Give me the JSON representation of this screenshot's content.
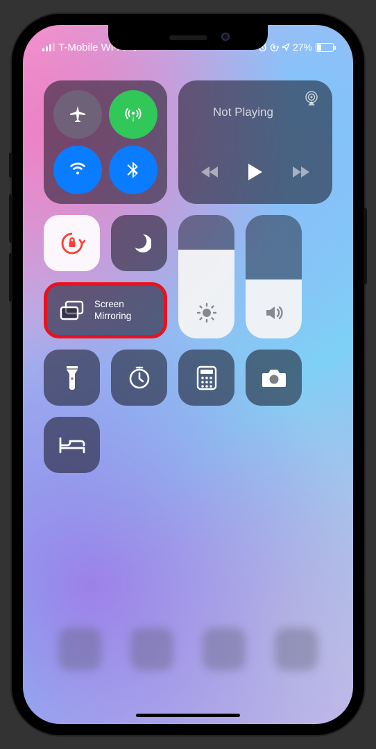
{
  "status": {
    "carrier": "T-Mobile Wi-Fi",
    "battery_pct": "27%"
  },
  "media": {
    "title": "Not Playing"
  },
  "screen_mirroring": {
    "label_line1": "Screen",
    "label_line2": "Mirroring"
  },
  "colors": {
    "highlight_ring": "#e8121e",
    "toggle_blue": "#0a7cff",
    "toggle_green": "#31c759"
  }
}
